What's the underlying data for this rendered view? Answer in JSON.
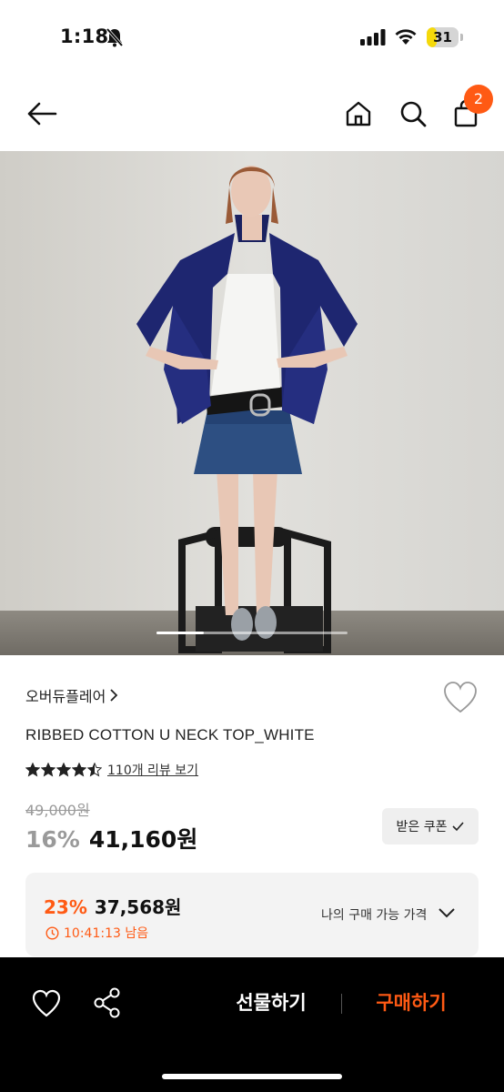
{
  "status": {
    "time": "1:18",
    "battery": "31",
    "battery_level": 0.31,
    "icons": [
      "bell-slash-icon",
      "signal-icon",
      "wifi-icon",
      "battery-icon"
    ]
  },
  "nav": {
    "cart_count": "2",
    "icons": [
      "arrow-left-icon",
      "home-icon",
      "search-icon",
      "bag-icon"
    ]
  },
  "product": {
    "brand": "오버듀플레어",
    "name": "RIBBED COTTON U NECK TOP_WHITE",
    "rating": 4.5,
    "review_link": "110개 리뷰 보기",
    "original_price": "49,000원",
    "discount": "16%",
    "price": "41,160원",
    "coupon_label": "받은 쿠폰"
  },
  "member_offer": {
    "discount": "23%",
    "price": "37,568원",
    "timer": "10:41:13 남음",
    "label": "나의 구매 가능 가격"
  },
  "bottom_bar": {
    "gift_label": "선물하기",
    "buy_label": "구매하기"
  },
  "colors": {
    "accent": "#ff5a14",
    "bottom_bar": "#000000"
  }
}
